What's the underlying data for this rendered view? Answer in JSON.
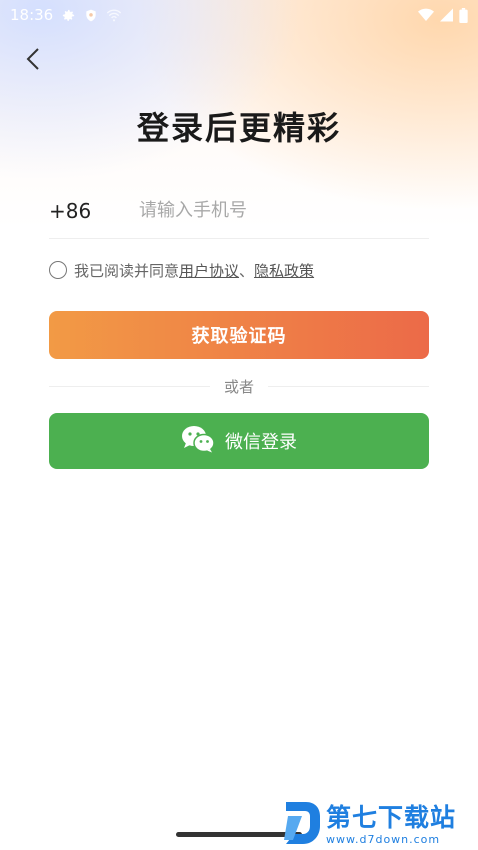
{
  "status_bar": {
    "time": "18:36",
    "icons_left": [
      "gear-icon",
      "shield-icon",
      "hotspot-icon"
    ],
    "icons_right": [
      "wifi-icon",
      "signal-icon",
      "battery-icon"
    ]
  },
  "header": {
    "back_icon": "chevron-left-icon",
    "title": "登录后更精彩"
  },
  "phone": {
    "country_code": "+86",
    "placeholder": "请输入手机号",
    "value": ""
  },
  "agreement": {
    "checked": false,
    "prefix": "我已阅读并同意",
    "user_agreement": "用户协议",
    "separator": "、",
    "privacy_policy": "隐私政策"
  },
  "actions": {
    "get_code_label": "获取验证码",
    "divider_text": "或者",
    "wechat_label": "微信登录",
    "wechat_color": "#4cb050",
    "primary_gradient": [
      "#f29a45",
      "#ec6a48"
    ]
  },
  "watermark": {
    "title": "第七下载站",
    "url": "www.d7down.com"
  }
}
